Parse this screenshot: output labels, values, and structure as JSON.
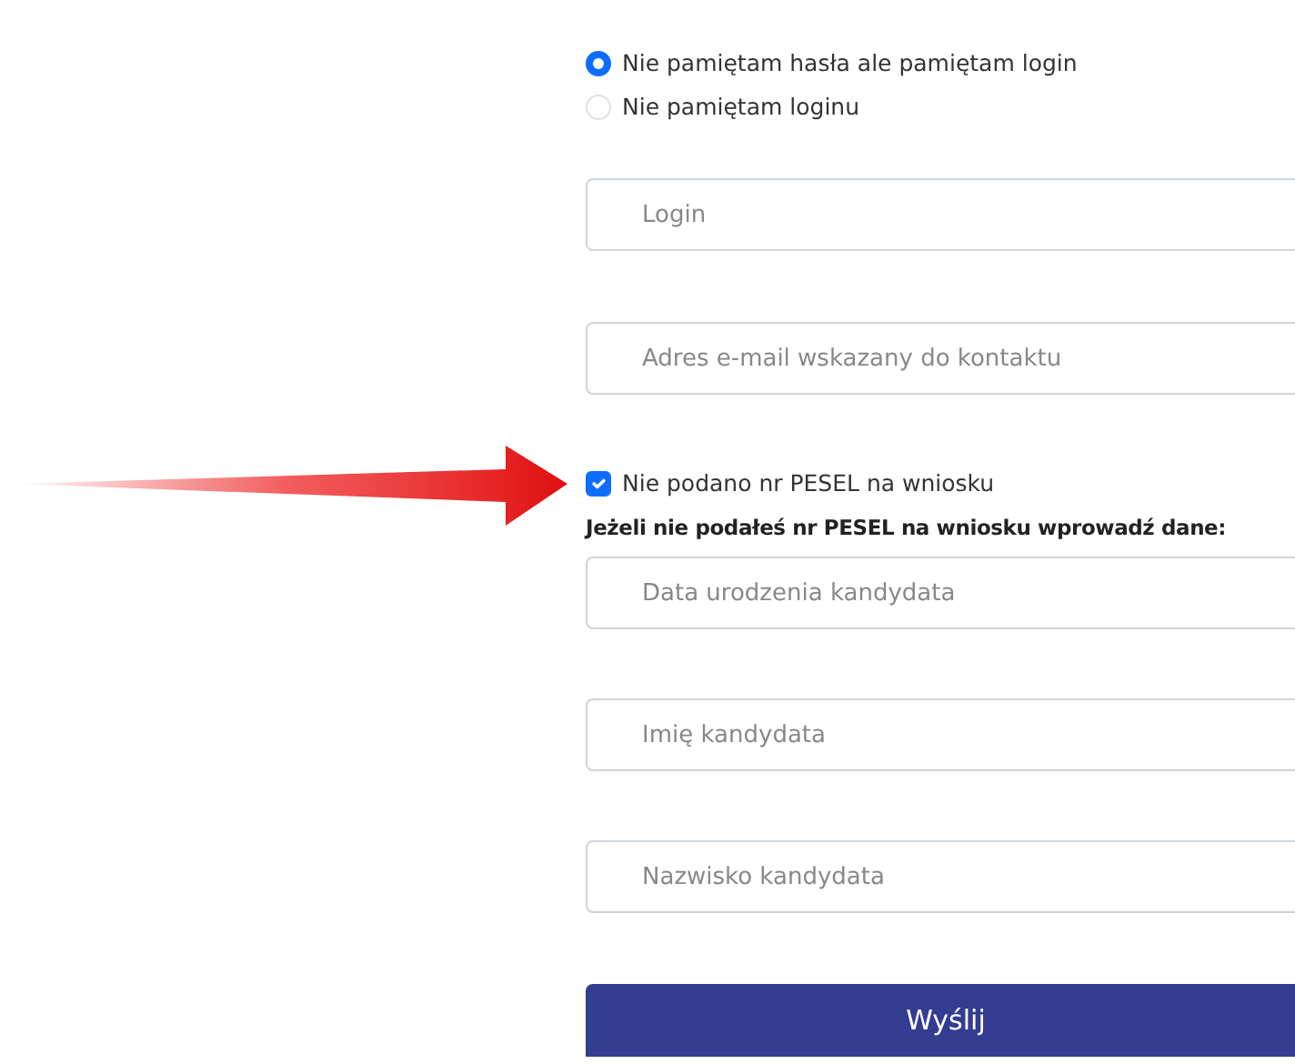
{
  "recovery_options": [
    {
      "label": "Nie pamiętam hasła ale pamiętam login",
      "selected": true
    },
    {
      "label": "Nie pamiętam loginu",
      "selected": false
    }
  ],
  "fields_top": [
    {
      "placeholder": "Login"
    },
    {
      "placeholder": "Adres e-mail wskazany do kontaktu"
    }
  ],
  "pesel_checkbox": {
    "label": "Nie podano nr PESEL na wniosku",
    "checked": true
  },
  "pesel_note": "Jeżeli nie podałeś nr PESEL na wniosku wprowadź dane:",
  "fields_bottom": [
    {
      "placeholder": "Data urodzenia kandydata"
    },
    {
      "placeholder": "Imię kandydata"
    },
    {
      "placeholder": "Nazwisko kandydata"
    }
  ],
  "submit_button": "Wyślij"
}
